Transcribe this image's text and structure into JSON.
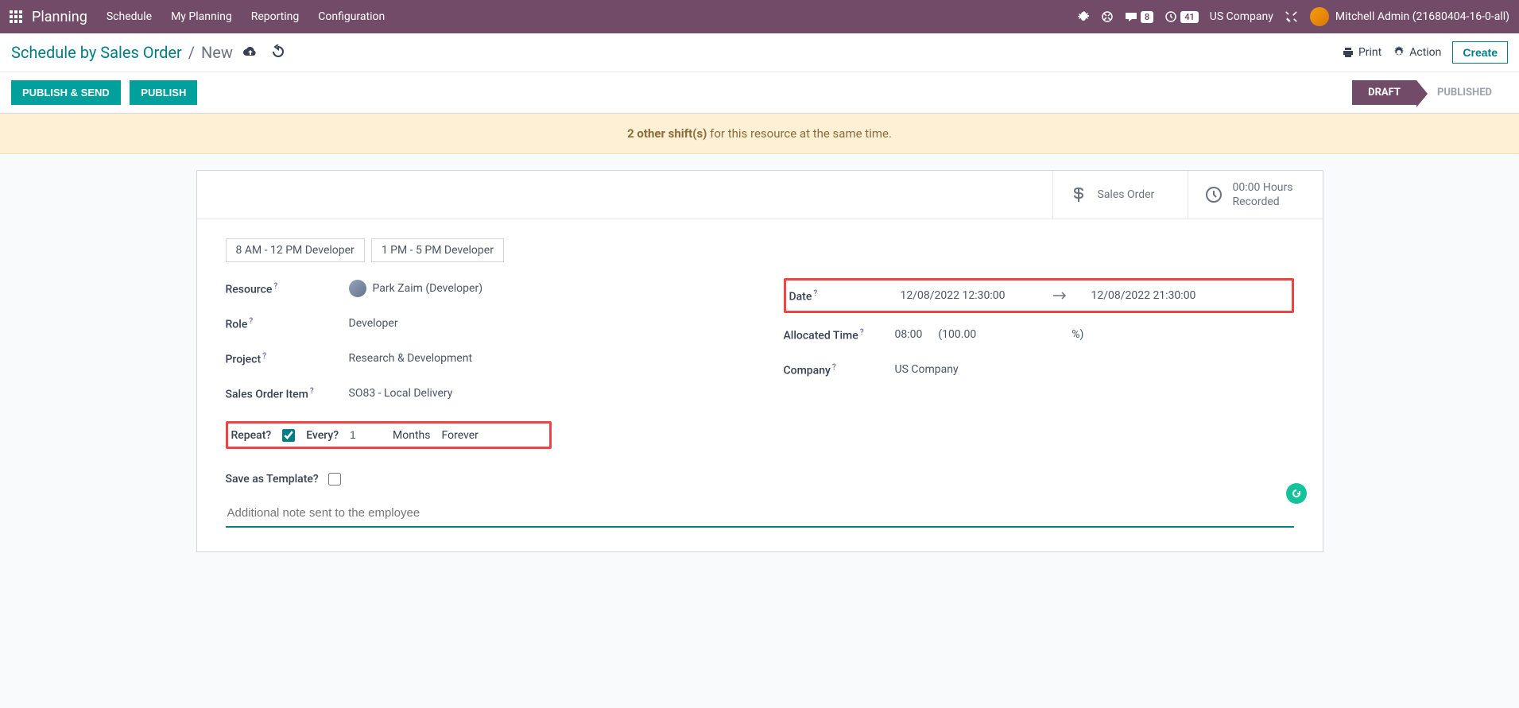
{
  "nav": {
    "app": "Planning",
    "links": [
      "Schedule",
      "My Planning",
      "Reporting",
      "Configuration"
    ],
    "msg_count": "8",
    "activity_count": "41",
    "company": "US Company",
    "user": "Mitchell Admin (21680404-16-0-all)"
  },
  "controlbar": {
    "crumb1": "Schedule by Sales Order",
    "crumb2": "New",
    "print": "Print",
    "action": "Action",
    "create": "Create"
  },
  "statusbar": {
    "publish_send": "PUBLISH & SEND",
    "publish": "PUBLISH",
    "stage_draft": "DRAFT",
    "stage_published": "PUBLISHED"
  },
  "warning": {
    "bold": "2 other shift(s)",
    "rest": " for this resource at the same time."
  },
  "statbtns": {
    "sales_order": "Sales Order",
    "hours_value": "00:00 Hours",
    "hours_label": "Recorded"
  },
  "templates": {
    "t1": "8 AM - 12 PM Developer",
    "t2": "1 PM - 5 PM Developer"
  },
  "fields": {
    "resource_label": "Resource",
    "resource_value": "Park Zaim (Developer)",
    "role_label": "Role",
    "role_value": "Developer",
    "project_label": "Project",
    "project_value": "Research & Development",
    "soi_label": "Sales Order Item",
    "soi_value": "SO83 - Local Delivery",
    "date_label": "Date",
    "date_start": "12/08/2022 12:30:00",
    "date_end": "12/08/2022 21:30:00",
    "alloc_label": "Allocated Time",
    "alloc_hours": "08:00",
    "alloc_pct_open": "(100.00",
    "alloc_pct_close": "%)",
    "company_label": "Company",
    "company_value": "US Company",
    "repeat_label": "Repeat",
    "every_label": "Every",
    "every_value": "1",
    "every_unit": "Months",
    "every_until": "Forever",
    "save_template_label": "Save as Template",
    "note_placeholder": "Additional note sent to the employee"
  }
}
